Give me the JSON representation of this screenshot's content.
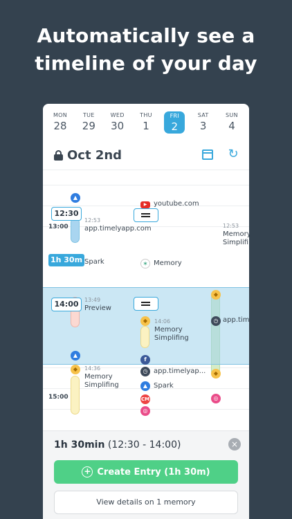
{
  "headline": {
    "line1": "Automatically see a",
    "line2": "timeline of your day"
  },
  "week": [
    {
      "name": "MON",
      "num": "28"
    },
    {
      "name": "TUE",
      "num": "29"
    },
    {
      "name": "WED",
      "num": "30"
    },
    {
      "name": "THU",
      "num": "1"
    },
    {
      "name": "FRI",
      "num": "2"
    },
    {
      "name": "SAT",
      "num": "3"
    },
    {
      "name": "SUN",
      "num": "4"
    }
  ],
  "selected_day": "FRI",
  "date_title": "Oct 2nd",
  "timeline": {
    "hour_1300": "13:00",
    "hour_1400": "14:00",
    "hour_1500": "15:00",
    "start_pill": "12:30",
    "end_pill": "14:00",
    "duration_pill": "1h 30m",
    "col1_time1": "12:53",
    "col1_entry1": "app.timelyapp.com",
    "col1_entry2": "Spark",
    "col1_time2": "13:49",
    "col1_entry3": "Preview",
    "col1_time3": "14:36",
    "col1_entry4": "Memory Simplifing",
    "col2_entry1": "youtube.com",
    "col2_entry2": "Memory",
    "col2_time1": "14:06",
    "col2_entry3": "Memory Simplifing",
    "col2_entry4": "app.timelyap...",
    "col2_entry5": "Spark",
    "col3_time1": "12:53",
    "col3_entry1": "Memory Simplifing",
    "col3_entry2": "app.timel"
  },
  "bottom": {
    "duration": "1h 30min",
    "range": "(12:30 - 14:00)",
    "create_label": "Create Entry (1h 30m)",
    "view_label": "View details on 1 memory"
  },
  "colors": {
    "accent": "#38a8dc",
    "green": "#4fd087",
    "background": "#34424f"
  }
}
